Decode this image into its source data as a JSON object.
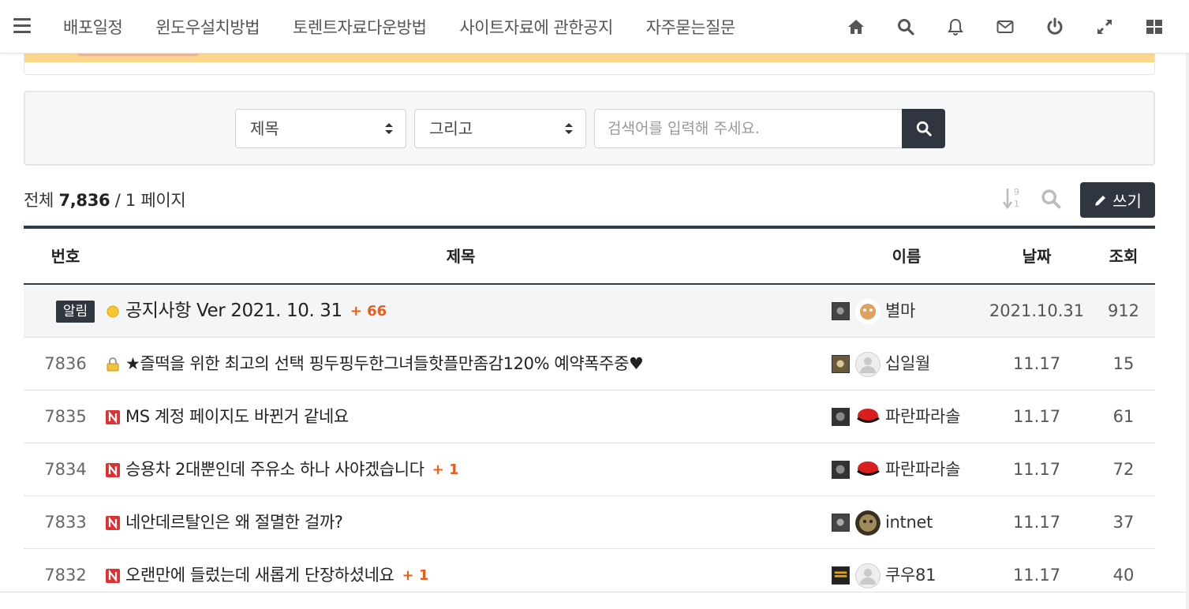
{
  "nav": {
    "links": [
      "배포일정",
      "윈도우설치방법",
      "토렌트자료다운방법",
      "사이트자료에 관한공지",
      "자주묻는질문"
    ],
    "icons": [
      "home-icon",
      "search-icon",
      "bell-icon",
      "envelope-icon",
      "power-icon",
      "expand-icon",
      "grid-icon"
    ]
  },
  "search": {
    "field_selected": "제목",
    "condition_selected": "그리고",
    "placeholder": "검색어를 입력해 주세요."
  },
  "list_header": {
    "total_label": "전체",
    "total_count": "7,836",
    "page_text": "/ 1 페이지",
    "write_label": "쓰기"
  },
  "table": {
    "columns": [
      "번호",
      "제목",
      "이름",
      "날짜",
      "조회"
    ],
    "notice": {
      "badge": "알림",
      "subject": "공지사항 Ver 2021. 10. 31",
      "comments": "+ 66",
      "name": "별마",
      "date": "2021.10.31",
      "hits": "912"
    },
    "rows": [
      {
        "num": "7836",
        "subject": "★즐떡을 위한 최고의 선택 핑두핑두한그녀들핫플만좀감120% 예약폭주중♥",
        "comments": "",
        "name": "십일월",
        "date": "11.17",
        "hits": "15"
      },
      {
        "num": "7835",
        "subject": "MS 계정 페이지도 바뀐거 같네요",
        "comments": "",
        "name": "파란파라솔",
        "date": "11.17",
        "hits": "61"
      },
      {
        "num": "7834",
        "subject": "승용차 2대뿐인데 주유소 하나 사야겠습니다",
        "comments": "+ 1",
        "name": "파란파라솔",
        "date": "11.17",
        "hits": "72"
      },
      {
        "num": "7833",
        "subject": "네안데르탈인은 왜 절멸한 걸까?",
        "comments": "",
        "name": "intnet",
        "date": "11.17",
        "hits": "37"
      },
      {
        "num": "7832",
        "subject": "오랜만에 들렀는데 새롭게 단장하셨네요",
        "comments": "+ 1",
        "name": "쿠우81",
        "date": "11.17",
        "hits": "40"
      }
    ]
  },
  "colors": {
    "dark": "#2f3640",
    "comment": "#e85d1a",
    "new_badge": "#e03131"
  }
}
